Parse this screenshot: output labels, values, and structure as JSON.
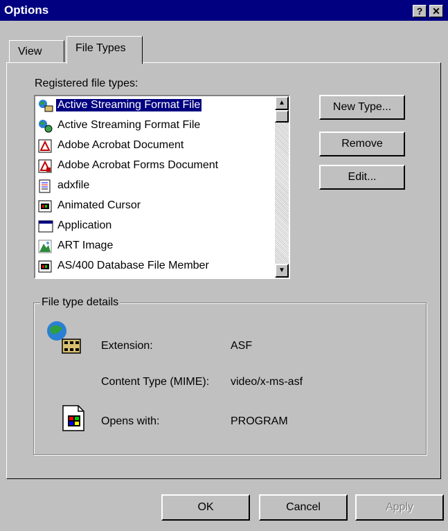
{
  "window": {
    "title": "Options",
    "help_button": "?",
    "close_button": "✕"
  },
  "tabs": [
    {
      "label": "View",
      "active": false
    },
    {
      "label": "File Types",
      "active": true
    }
  ],
  "file_types": {
    "label": "Registered file types:",
    "items": [
      {
        "label": "Active Streaming Format File",
        "icon": "streaming-media-icon",
        "selected": true
      },
      {
        "label": "Active Streaming Format File",
        "icon": "streaming-media-icon",
        "selected": false
      },
      {
        "label": "Adobe Acrobat Document",
        "icon": "acrobat-icon",
        "selected": false
      },
      {
        "label": "Adobe Acrobat Forms Document",
        "icon": "acrobat-forms-icon",
        "selected": false
      },
      {
        "label": "adxfile",
        "icon": "adx-file-icon",
        "selected": false
      },
      {
        "label": "Animated Cursor",
        "icon": "cursor-file-icon",
        "selected": false
      },
      {
        "label": "Application",
        "icon": "application-window-icon",
        "selected": false
      },
      {
        "label": "ART Image",
        "icon": "art-image-icon",
        "selected": false
      },
      {
        "label": "AS/400 Database File Member",
        "icon": "database-file-icon",
        "selected": false
      }
    ]
  },
  "buttons": {
    "new_type": "New Type...",
    "remove": "Remove",
    "edit": "Edit..."
  },
  "details": {
    "title": "File type details",
    "extension_label": "Extension:",
    "extension_value": "ASF",
    "content_type_label": "Content Type (MIME):",
    "content_type_value": "video/x-ms-asf",
    "opens_with_label": "Opens with:",
    "opens_with_value": "PROGRAM"
  },
  "dialog_buttons": {
    "ok": "OK",
    "cancel": "Cancel",
    "apply": "Apply"
  },
  "colors": {
    "title_bar": "#000080",
    "face": "#c0c0c0",
    "selection": "#000080"
  }
}
